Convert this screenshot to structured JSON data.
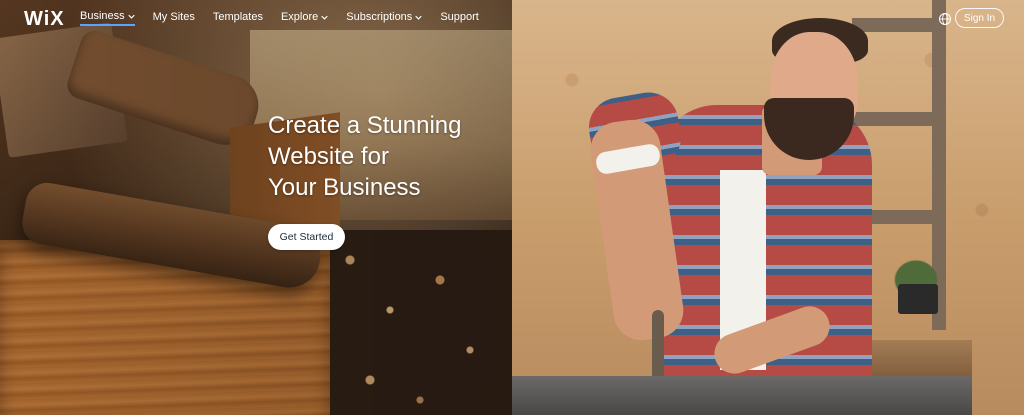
{
  "brand": {
    "logo_text": "WiX"
  },
  "nav": {
    "items": [
      {
        "label": "Business",
        "dropdown": true,
        "active": true
      },
      {
        "label": "My Sites",
        "dropdown": false,
        "active": false
      },
      {
        "label": "Templates",
        "dropdown": false,
        "active": false
      },
      {
        "label": "Explore",
        "dropdown": true,
        "active": false
      },
      {
        "label": "Subscriptions",
        "dropdown": true,
        "active": false
      },
      {
        "label": "Support",
        "dropdown": false,
        "active": false
      }
    ],
    "active_underline_color": "#5aa3ff"
  },
  "header_right": {
    "language_icon": "globe-icon",
    "signin_label": "Sign In"
  },
  "hero": {
    "headline_lines": [
      "Create a Stunning",
      "Website for",
      "Your Business"
    ],
    "cta_label": "Get Started"
  }
}
